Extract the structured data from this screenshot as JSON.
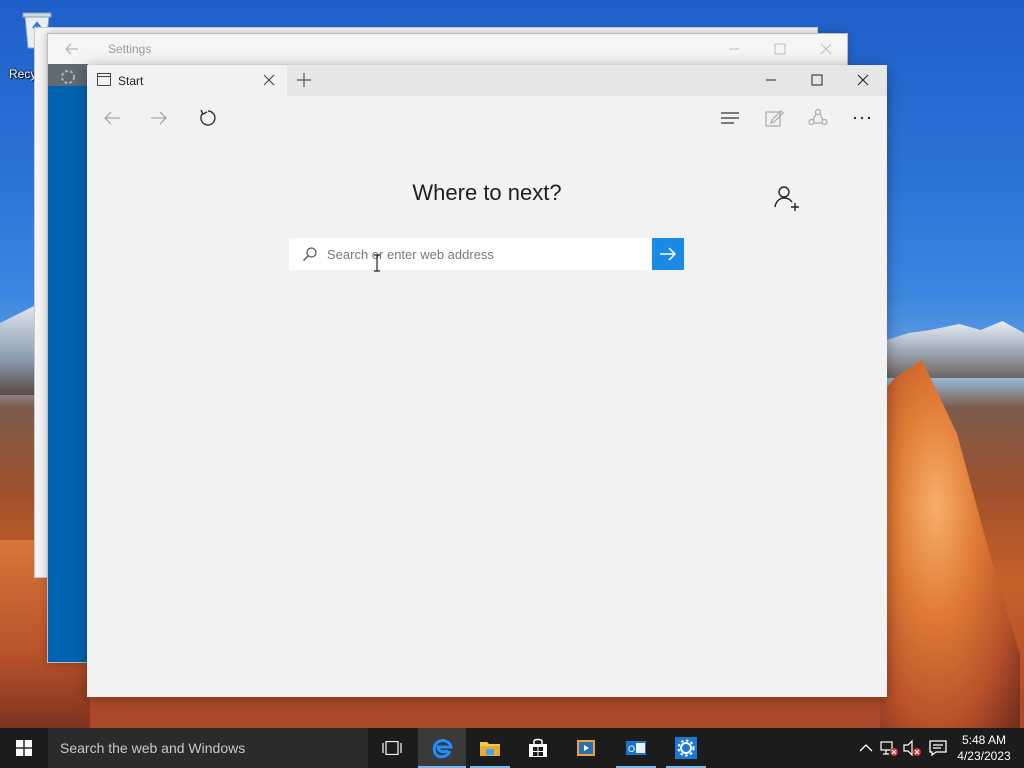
{
  "desktop": {
    "recycle_bin_label": "Recy"
  },
  "settings_window": {
    "title": "Settings"
  },
  "edge": {
    "tab": {
      "title": "Start"
    },
    "toolbar": {
      "back_icon": "arrow-left-icon",
      "forward_icon": "arrow-right-icon",
      "refresh_icon": "refresh-icon",
      "hub_icon": "hub-icon",
      "note_icon": "web-note-icon",
      "share_icon": "share-icon",
      "more_icon": "more-icon"
    },
    "headline": "Where to next?",
    "search": {
      "placeholder": "Search or enter web address"
    }
  },
  "taskbar": {
    "search_text": "Search the web and Windows",
    "apps": [
      "Edge",
      "File Explorer",
      "Store",
      "Media Player",
      "Outlook",
      "Settings"
    ],
    "clock": {
      "time": "5:48 AM",
      "date": "4/23/2023"
    }
  },
  "colors": {
    "accent": "#1a8ae5",
    "settings_sidebar": "#0063b1",
    "taskbar": "#1c1c1c"
  }
}
